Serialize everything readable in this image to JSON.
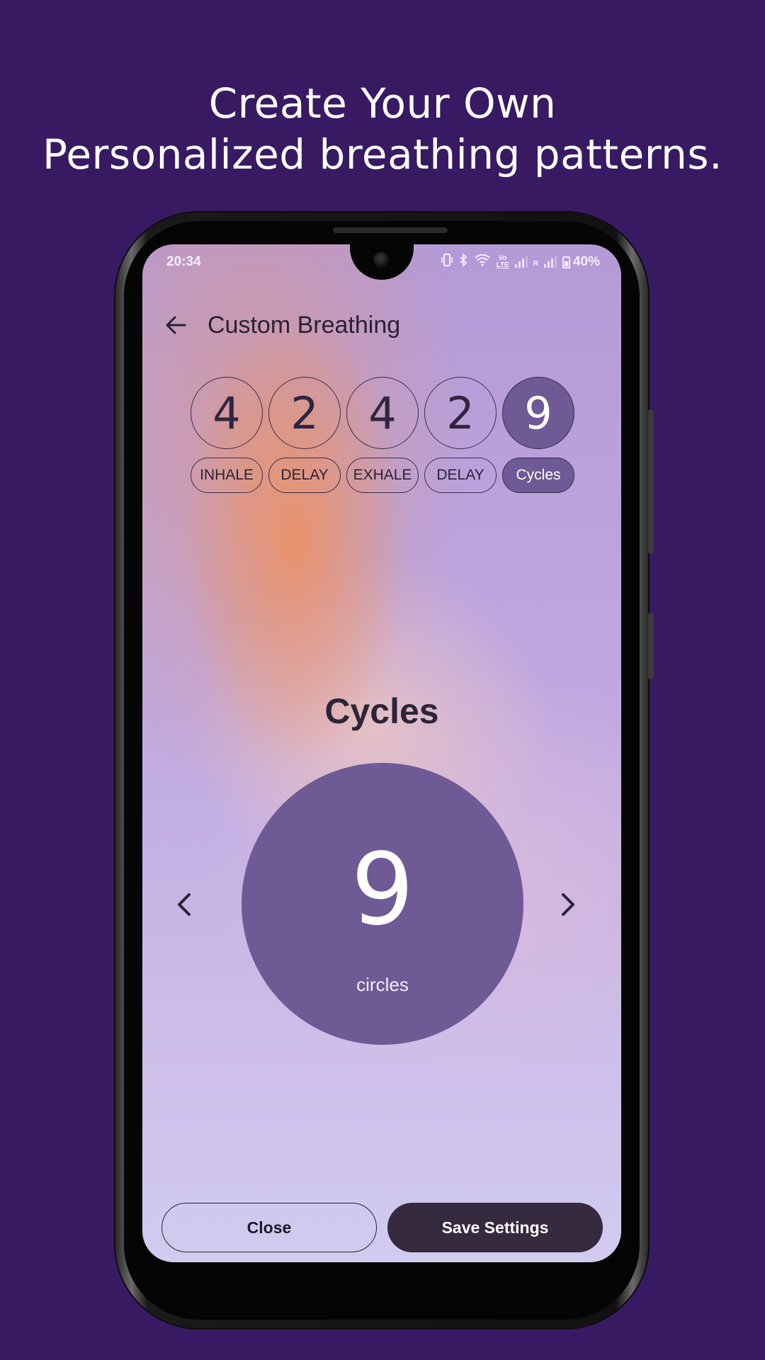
{
  "headline": {
    "line1": "Create Your Own",
    "line2": "Personalized breathing patterns."
  },
  "status_bar": {
    "time": "20:34",
    "network_volte": "Vo",
    "network_lte": "LTE",
    "roaming": "R",
    "battery": "40%"
  },
  "header": {
    "back_icon": "arrow-left-icon",
    "title": "Custom Breathing"
  },
  "phases": [
    {
      "value": "4",
      "label": "INHALE",
      "active": false
    },
    {
      "value": "2",
      "label": "DELAY",
      "active": false
    },
    {
      "value": "4",
      "label": "EXHALE",
      "active": false
    },
    {
      "value": "2",
      "label": "DELAY",
      "active": false
    },
    {
      "value": "9",
      "label": "Cycles",
      "active": true
    }
  ],
  "editor": {
    "title": "Cycles",
    "value": "9",
    "unit": "circles",
    "prev_icon": "chevron-left-icon",
    "next_icon": "chevron-right-icon"
  },
  "actions": {
    "close_label": "Close",
    "save_label": "Save Settings"
  },
  "colors": {
    "page_background": "#381a63",
    "accent": "#6e5a94",
    "button_dark": "#352a3e"
  }
}
